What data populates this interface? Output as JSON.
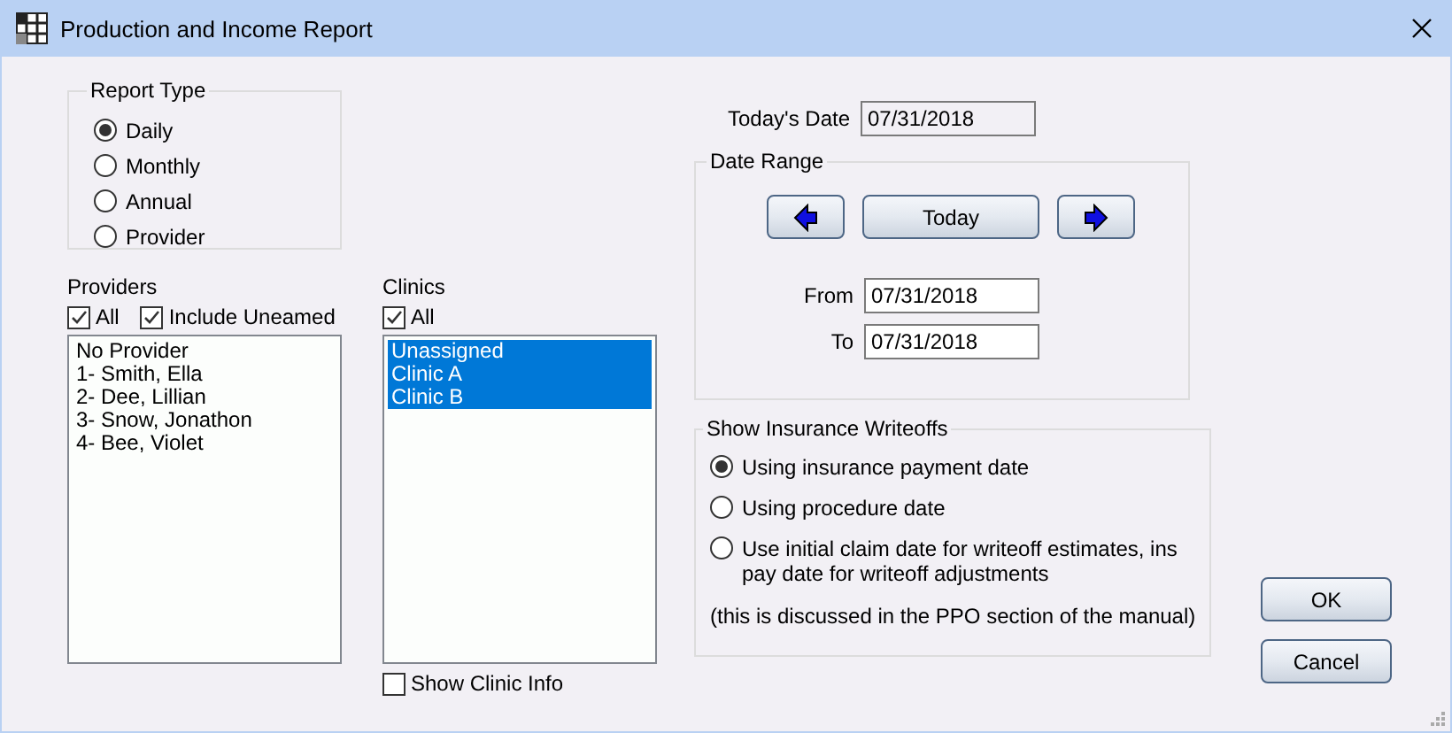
{
  "window": {
    "title": "Production and Income Report"
  },
  "report_type": {
    "title": "Report Type",
    "options": [
      {
        "label": "Daily",
        "selected": true
      },
      {
        "label": "Monthly",
        "selected": false
      },
      {
        "label": "Annual",
        "selected": false
      },
      {
        "label": "Provider",
        "selected": false
      }
    ]
  },
  "providers": {
    "label": "Providers",
    "checkboxes": [
      {
        "label": "All",
        "checked": true
      },
      {
        "label": "Include Uneamed",
        "checked": true
      }
    ],
    "items": [
      {
        "label": "No Provider",
        "selected": false
      },
      {
        "label": "1- Smith, Ella",
        "selected": false
      },
      {
        "label": "2- Dee, Lillian",
        "selected": false
      },
      {
        "label": "3- Snow, Jonathon",
        "selected": false
      },
      {
        "label": "4- Bee, Violet",
        "selected": false
      }
    ]
  },
  "clinics": {
    "label": "Clinics",
    "checkboxes": [
      {
        "label": "All",
        "checked": true
      }
    ],
    "items": [
      {
        "label": "Unassigned",
        "selected": true
      },
      {
        "label": "Clinic A",
        "selected": true
      },
      {
        "label": "Clinic B",
        "selected": true
      }
    ],
    "show_clinic_info": {
      "label": "Show Clinic Info",
      "checked": false
    }
  },
  "todays_date": {
    "label": "Today's Date",
    "value": "07/31/2018",
    "read_only": true
  },
  "date_range": {
    "title": "Date Range",
    "buttons": [
      {
        "kind": "prev"
      },
      {
        "kind": "today",
        "label": "Today"
      },
      {
        "kind": "next"
      }
    ],
    "from": {
      "label": "From",
      "value": "07/31/2018",
      "read_only": false
    },
    "to": {
      "label": "To",
      "value": "07/31/2018",
      "read_only": false
    }
  },
  "insurance_writeoffs": {
    "title": "Show Insurance Writeoffs",
    "options": [
      {
        "label": "Using insurance payment date",
        "selected": true
      },
      {
        "label": "Using procedure date",
        "selected": false
      },
      {
        "label": "Use initial claim date for writeoff estimates, ins pay date for writeoff adjustments",
        "selected": false
      }
    ],
    "note": "(this is discussed in the PPO section of the manual)"
  },
  "buttons": [
    {
      "label": "OK"
    },
    {
      "label": "Cancel"
    }
  ]
}
